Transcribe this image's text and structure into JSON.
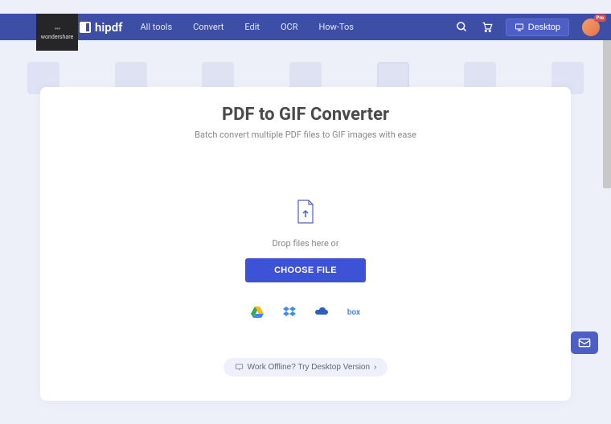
{
  "brand": {
    "parent": "wondershare",
    "name": "hipdf"
  },
  "nav": {
    "items": [
      "All tools",
      "Convert",
      "Edit",
      "OCR",
      "How-Tos"
    ]
  },
  "header": {
    "desktop_label": "Desktop",
    "pro_badge": "Pro"
  },
  "main": {
    "title": "PDF to GIF Converter",
    "subtitle": "Batch convert multiple PDF files to GIF images with ease",
    "drop_text": "Drop files here or",
    "choose_label": "CHOOSE FILE"
  },
  "cloud": {
    "drive": "google-drive",
    "dropbox": "dropbox",
    "onedrive": "onedrive",
    "box": "box"
  },
  "footer": {
    "offline_label": "Work Offline? Try Desktop Version",
    "offline_arrow": "›"
  }
}
